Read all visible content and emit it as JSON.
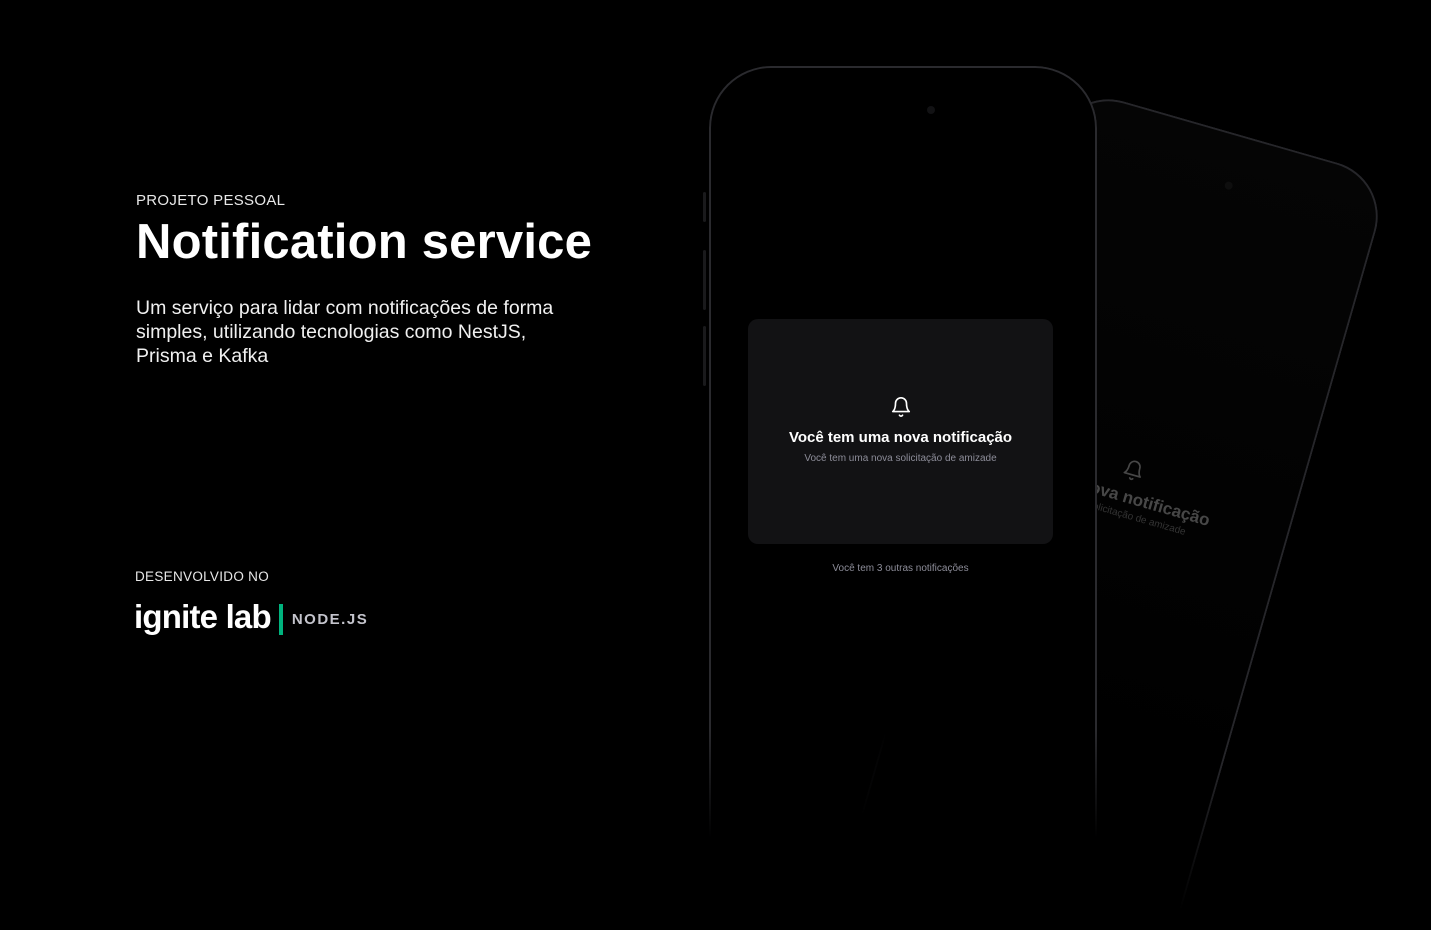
{
  "intro": {
    "eyebrow": "PROJETO PESSOAL",
    "title": "Notification service",
    "description": "Um serviço para lidar com notificações de forma simples, utilizando tecnologias como NestJS, Prisma e Kafka"
  },
  "developed_at": {
    "label": "DESENVOLVIDO NO",
    "brand_name": "ignite lab",
    "brand_tech": "NODE.JS",
    "accent_color": "#00b37e"
  },
  "phone_front": {
    "notification": {
      "icon": "bell-icon",
      "title": "Você tem uma nova notificação",
      "subtitle": "Você tem uma nova solicitação de amizade"
    },
    "more_text": "Você tem 3 outras notificações"
  },
  "phone_back": {
    "notification": {
      "icon": "bell-icon",
      "title": "uma nova notificação",
      "subtitle": "a nova solicitação de amizade"
    }
  }
}
